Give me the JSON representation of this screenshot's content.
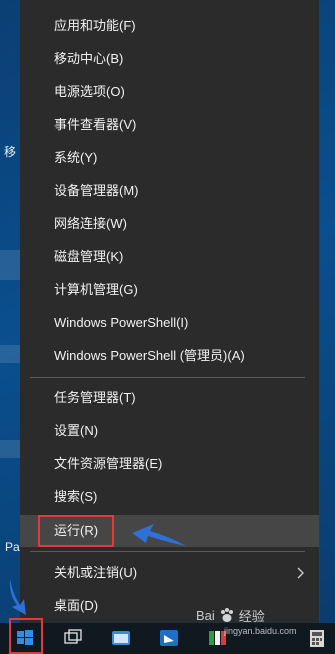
{
  "desktop": {
    "left_label": "移",
    "pa_label": "Pa"
  },
  "menu": {
    "items": [
      {
        "label": "应用和功能(F)"
      },
      {
        "label": "移动中心(B)"
      },
      {
        "label": "电源选项(O)"
      },
      {
        "label": "事件查看器(V)"
      },
      {
        "label": "系统(Y)"
      },
      {
        "label": "设备管理器(M)"
      },
      {
        "label": "网络连接(W)"
      },
      {
        "label": "磁盘管理(K)"
      },
      {
        "label": "计算机管理(G)"
      },
      {
        "label": "Windows PowerShell(I)"
      },
      {
        "label": "Windows PowerShell (管理员)(A)"
      },
      {
        "label": "任务管理器(T)"
      },
      {
        "label": "设置(N)"
      },
      {
        "label": "文件资源管理器(E)"
      },
      {
        "label": "搜索(S)"
      },
      {
        "label": "运行(R)"
      },
      {
        "label": "关机或注销(U)"
      },
      {
        "label": "桌面(D)"
      }
    ],
    "selected_item": "运行(R)",
    "highlight_color": "#e03a3a"
  },
  "watermark": {
    "logo_text": "Bai",
    "brand": "经验",
    "url": "jingyan.baidu.com"
  },
  "colors": {
    "menu_bg": "#2b2b2b",
    "menu_text": "#f2f2f2",
    "accent_arrow": "#2f6fd6",
    "annotation_red": "#e03a3a"
  }
}
